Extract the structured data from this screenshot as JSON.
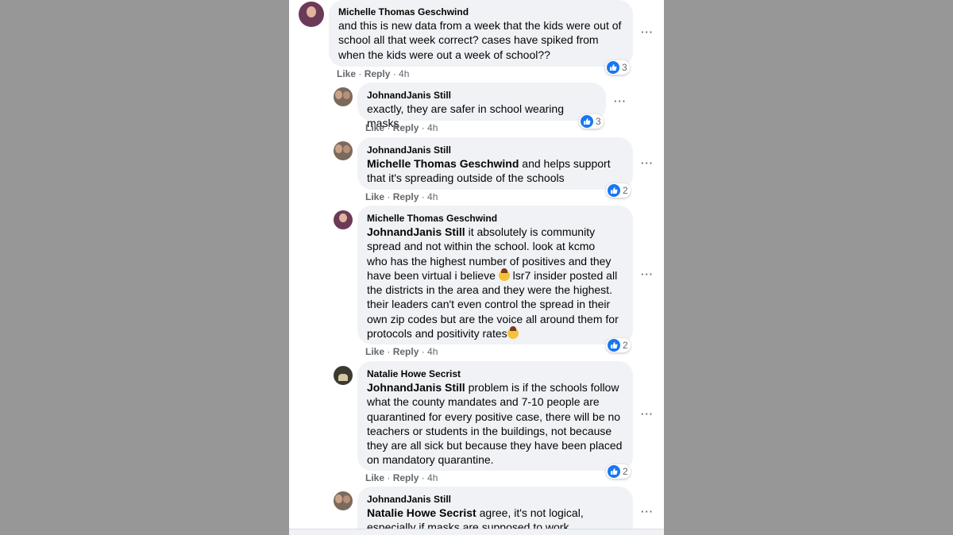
{
  "comments": [
    {
      "author": "Michelle Thomas Geschwind",
      "text": "and this is new data from a week that the kids were out of school all that week correct? cases have spiked from when the kids were out a week of school??",
      "reactions": "3",
      "like": "Like",
      "reply": "Reply",
      "time": "4h",
      "avatar_icon": "avatar-photo"
    },
    {
      "author": "JohnandJanis Still",
      "text": "exactly, they are safer in school wearing masks",
      "reactions": "3",
      "like": "Like",
      "reply": "Reply",
      "time": "4h",
      "avatar_icon": "avatar-photo"
    },
    {
      "author": "JohnandJanis Still",
      "mention": "Michelle Thomas Geschwind",
      "text_l1": " and helps support",
      "text_l2": "that it's spreading outside of the schools",
      "reactions": "2",
      "like": "Like",
      "reply": "Reply",
      "time": "4h",
      "avatar_icon": "avatar-photo"
    },
    {
      "author": "Michelle Thomas Geschwind",
      "mention": "JohnandJanis Still",
      "text_l1": " it absolutely is community",
      "text_lines": [
        "spread and not within the school. look at kcmo",
        "who has the highest number of positives and they",
        "have been virtual i believe",
        "the districts in the area and they were the highest.",
        "their leaders can't even control the spread in their",
        "own zip codes but are the voice all around them for",
        "protocols and positivity rates"
      ],
      "text_after_emoji": " lsr7 insider posted all",
      "reactions": "2",
      "like": "Like",
      "reply": "Reply",
      "time": "4h",
      "avatar_icon": "avatar-photo"
    },
    {
      "author": "Natalie Howe Secrist",
      "mention": "JohnandJanis Still",
      "text_l1": " problem is if the schools follow",
      "text_lines": [
        "what the county mandates and 7-10 people are",
        "quarantined for every positive case, there will be no",
        "teachers or students in the buildings, not because",
        "they are all sick but because they have been placed",
        "on mandatory quarantine."
      ],
      "reactions": "2",
      "like": "Like",
      "reply": "Reply",
      "time": "4h",
      "avatar_icon": "avatar-photo"
    },
    {
      "author": "JohnandJanis Still",
      "mention": "Natalie Howe Secrist",
      "text_l1": " agree, it's not logical,",
      "text_l2": "especially if masks are supposed to work",
      "avatar_icon": "avatar-photo"
    }
  ],
  "ui": {
    "more_glyph": "···",
    "separator": " · ",
    "like_icon": "thumbs-up-icon",
    "like_color": "#1877f2",
    "bubble_color": "#f0f2f5",
    "backdrop_color": "#979797"
  }
}
